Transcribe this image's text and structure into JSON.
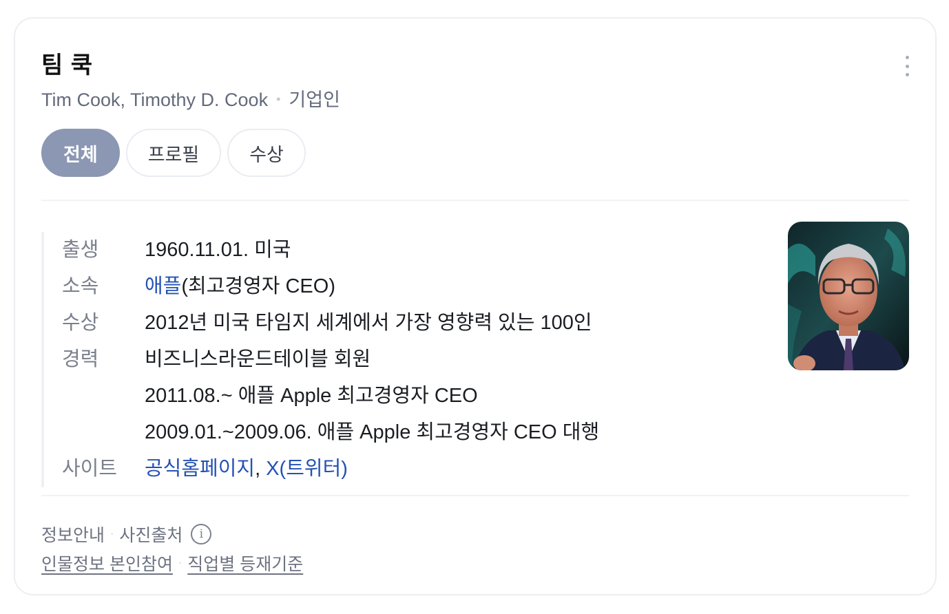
{
  "header": {
    "title": "팀 쿡",
    "aliases": "Tim Cook, Timothy D. Cook",
    "separator": "•",
    "occupation": "기업인",
    "more_icon": "more-vertical-icon"
  },
  "tabs": [
    {
      "label": "전체",
      "active": true
    },
    {
      "label": "프로필",
      "active": false
    },
    {
      "label": "수상",
      "active": false
    }
  ],
  "profile": {
    "birth": {
      "label": "출생",
      "value": "1960.11.01. 미국"
    },
    "affiliation": {
      "label": "소속",
      "link": "애플",
      "rest": "(최고경영자 CEO)"
    },
    "award": {
      "label": "수상",
      "value": "2012년 미국 타임지 세계에서 가장 영향력 있는 100인"
    },
    "career": {
      "label": "경력",
      "items": [
        "비즈니스라운드테이블 회원",
        "2011.08.~ 애플 Apple 최고경영자 CEO",
        "2009.01.~2009.06. 애플 Apple 최고경영자 CEO 대행"
      ]
    },
    "site": {
      "label": "사이트",
      "official": "공식홈페이지",
      "comma": ",",
      "x": "X(트위터)"
    }
  },
  "footer": {
    "info_guide": "정보안내",
    "dot": "·",
    "photo_source": "사진출처",
    "info_icon": "info-circle-icon",
    "participate": "인물정보 본인참여",
    "criteria": "직업별 등재기준"
  },
  "colors": {
    "accent_tab": "#8b97b3",
    "link": "#2452b3"
  }
}
